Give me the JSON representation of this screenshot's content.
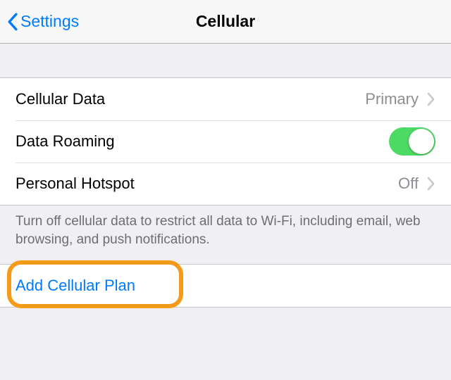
{
  "header": {
    "back_label": "Settings",
    "title": "Cellular"
  },
  "rows": {
    "cellular_data": {
      "label": "Cellular Data",
      "value": "Primary"
    },
    "data_roaming": {
      "label": "Data Roaming"
    },
    "personal_hotspot": {
      "label": "Personal Hotspot",
      "value": "Off"
    }
  },
  "footer_note": "Turn off cellular data to restrict all data to Wi-Fi, including email, web browsing, and push notifications.",
  "add_plan": {
    "label": "Add Cellular Plan"
  },
  "colors": {
    "accent": "#007aff",
    "switch_on": "#4cd964",
    "highlight": "#f59b1a"
  }
}
